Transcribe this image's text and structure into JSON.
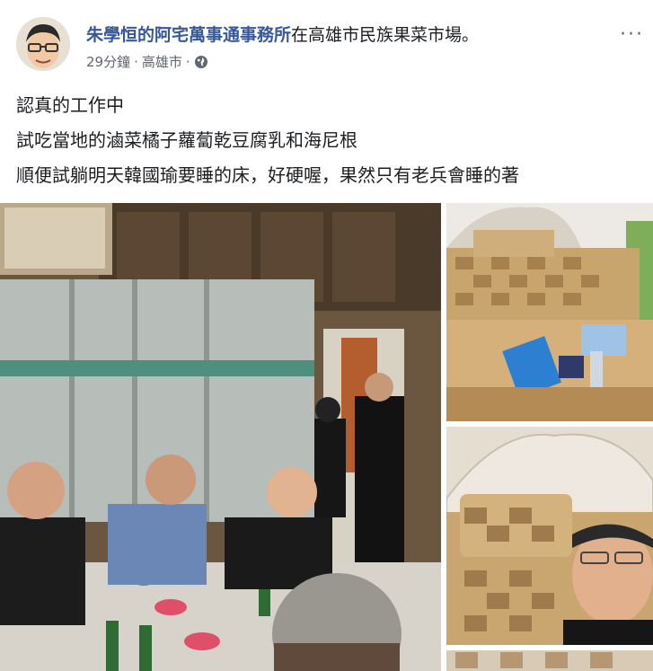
{
  "post": {
    "page_name": "朱學恒的阿宅萬事通事務所",
    "location_text": "在高雄市民族果菜市場。",
    "time": "29分鐘",
    "separator": "·",
    "place": "高雄市",
    "separator2": "·",
    "privacy_icon": "globe-icon",
    "more_icon": "more-options-icon",
    "more_glyph": "···",
    "lines": [
      "認真的工作中",
      "試吃當地的滷菜橘子蘿蔔乾豆腐乳和海尼根",
      "順便試躺明天韓國瑜要睡的床，好硬喔，果然只有老兵會睡的著"
    ]
  },
  "colors": {
    "link": "#385898",
    "meta": "#616770"
  },
  "photos": [
    {
      "subject": "dining-table-with-men"
    },
    {
      "subject": "bed-with-items"
    },
    {
      "subject": "man-lying-on-bed"
    },
    {
      "subject": "bed-partial"
    }
  ]
}
